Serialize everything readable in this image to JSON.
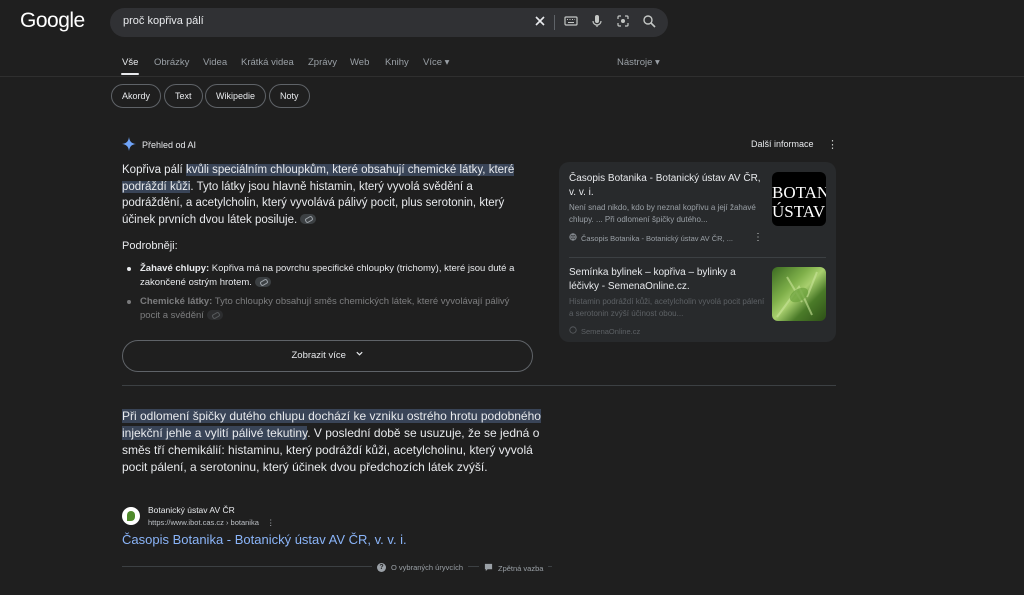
{
  "header": {
    "logo": "Google",
    "query": "proč kopřiva pálí"
  },
  "tabs": [
    "Vše",
    "Obrázky",
    "Videa",
    "Krátká videa",
    "Zprávy",
    "Web",
    "Knihy",
    "Více ▾"
  ],
  "tools": "Nástroje ▾",
  "chips": [
    "Akordy",
    "Text",
    "Wikipedie",
    "Noty"
  ],
  "ai": {
    "title": "Přehled od AI",
    "more_info": "Další informace",
    "p1_start": "Kopřiva pálí ",
    "p1_hl": "kvůli speciálním chloupkům, které obsahují chemické látky, které podráždí kůži",
    "p1_rest": ". Tyto látky jsou hlavně histamin, který vyvolá svědění a podráždění, a acetylcholin, který vyvolává pálivý pocit, plus serotonin, který účinek prvních dvou látek posiluje.",
    "details": "Podrobněji:",
    "b1_bold": "Žahavé chlupy:",
    "b1_text": " Kopřiva má na povrchu specifické chloupky (trichomy), které jsou duté a zakončené ostrým hrotem.",
    "b2_bold": "Chemické látky:",
    "b2_text": " Tyto chloupky obsahují směs chemických látek, které vyvolávají pálivý pocit a svědění",
    "show_more": "Zobrazit více"
  },
  "sources": [
    {
      "title": "Časopis Botanika - Botanický ústav AV ČR, v. v. i.",
      "snippet": "Není snad nikdo, kdo by neznal kopřivu a její žahavé chlupy. ... Při odlomení špičky dutého...",
      "site": "Časopis Botanika - Botanický ústav AV ČR, ...",
      "thumb_text": "BOTAN ÚSTAV"
    },
    {
      "title": "Semínka bylinek – kopřiva – bylinky a léčivky - SemenaOnline.cz.",
      "snippet": "Histamin podráždí kůži, acetylcholin vyvolá pocit pálení a serotonin zvýší účinost obou...",
      "site": "SemenaOnline.cz"
    }
  ],
  "snippet": {
    "hl": "Při odlomení špičky dutého chlupu dochází ke vzniku ostrého hrotu podobného injekční jehle a vylití pálivé tekutiny",
    "rest": ". V poslední době se usuzuje, že se jedná o směs tří chemikálií: histaminu, který podráždí kůži, acetylcholinu, který vyvolá pocit pálení, a serotoninu, který účinek dvou předchozích látek zvýší.",
    "site_name": "Botanický ústav AV ČR",
    "site_url": "https://www.ibot.cas.cz › botanika",
    "link": "Časopis Botanika - Botanický ústav AV ČR, v. v. i."
  },
  "footer": {
    "about": "O vybraných úryvcích",
    "feedback": "Zpětná vazba"
  }
}
